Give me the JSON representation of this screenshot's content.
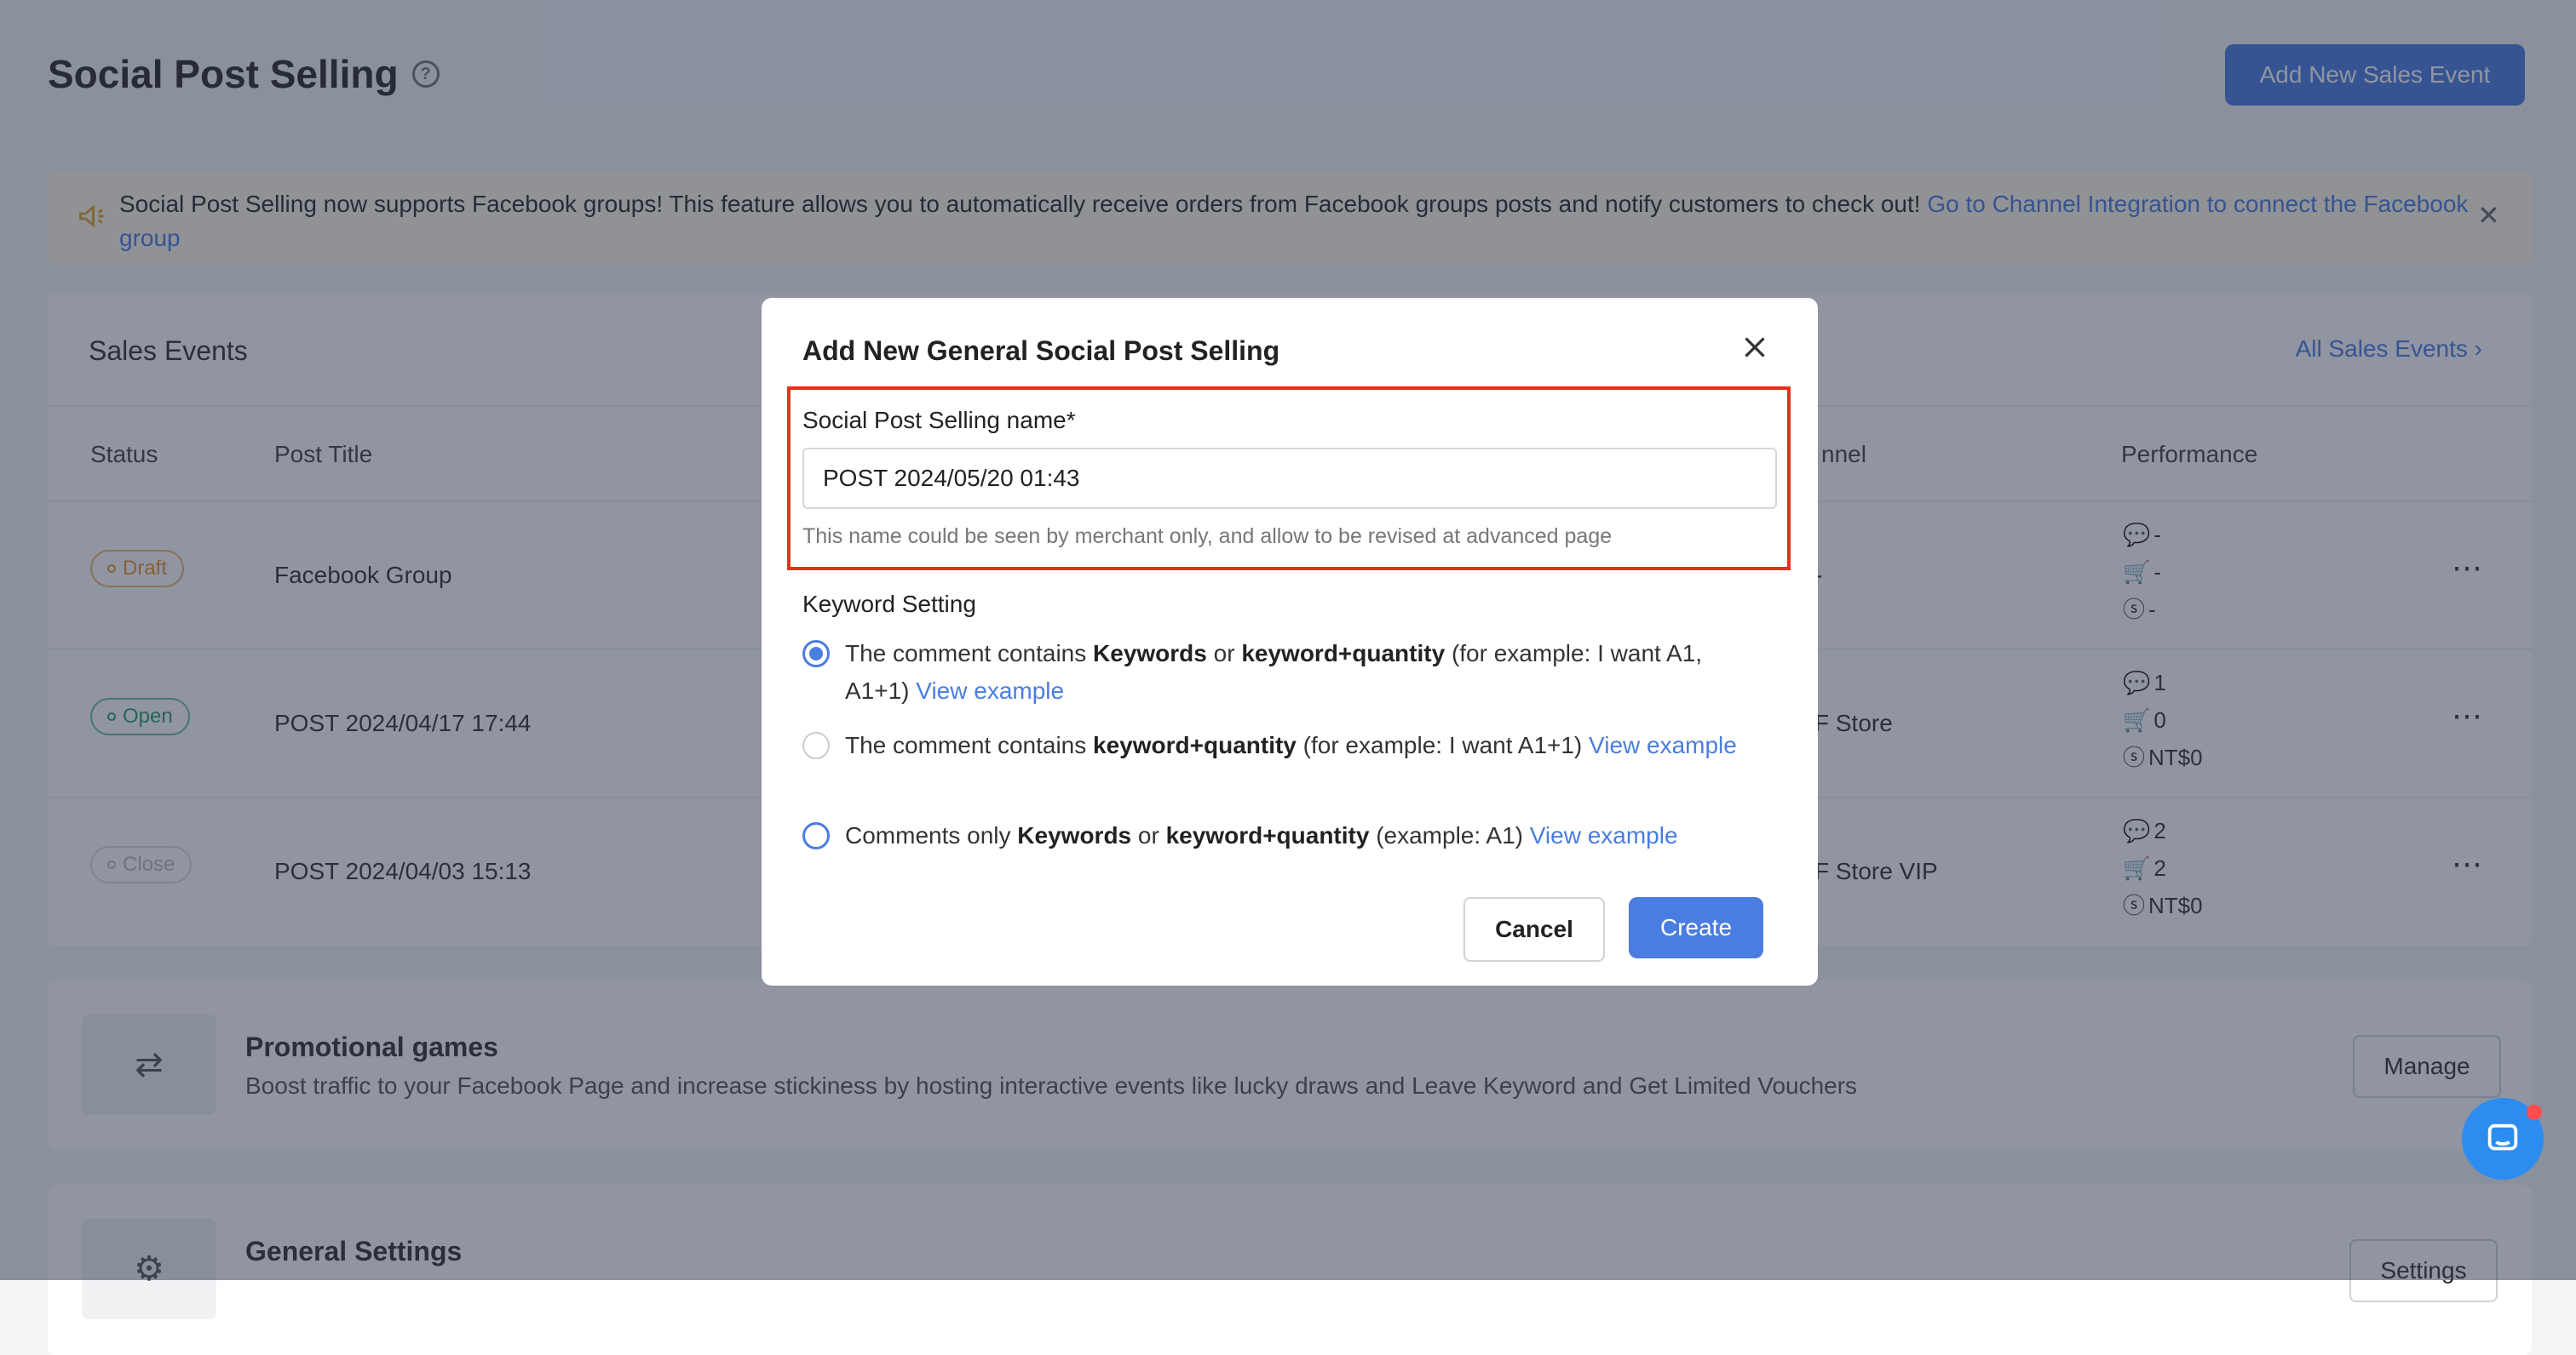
{
  "page": {
    "title": "Social Post Selling",
    "add_event_label": "Add New Sales Event"
  },
  "banner": {
    "text": "Social Post Selling now supports Facebook groups! This feature allows you to automatically receive orders from Facebook groups posts and notify customers to check out! ",
    "link": "Go to Channel Integration to connect the Facebook group"
  },
  "sales_events": {
    "title": "Sales Events",
    "all_link": "All Sales Events ›",
    "columns": [
      "Status",
      "Post Title",
      "nnel",
      "Performance"
    ],
    "rows": [
      {
        "status": "Draft",
        "title": "Facebook Group",
        "channel": "-",
        "comments": "-",
        "orders": "-",
        "revenue": "-"
      },
      {
        "status": "Open",
        "title": "POST 2024/04/17 17:44",
        "channel": "F Store",
        "comments": "1",
        "orders": "0",
        "revenue": "NT$0"
      },
      {
        "status": "Close",
        "title": "POST 2024/04/03 15:13",
        "channel": "F Store VIP",
        "comments": "2",
        "orders": "2",
        "revenue": "NT$0"
      }
    ]
  },
  "promo": {
    "title": "Promotional games",
    "subtitle": "Boost traffic to your Facebook Page and increase stickiness by hosting interactive events like lucky draws and Leave Keyword and Get Limited Vouchers",
    "button": "Manage"
  },
  "settings": {
    "title": "General Settings",
    "button": "Settings"
  },
  "modal": {
    "title": "Add New General Social Post Selling",
    "name_label": "Social Post Selling name*",
    "name_value": "POST 2024/05/20 01:43",
    "name_hint": "This name could be seen by merchant only, and allow to be revised at advanced page",
    "keyword_label": "Keyword Setting",
    "options": [
      {
        "pre": "The comment contains ",
        "b1": "Keywords",
        "mid": " or ",
        "b2": "keyword+quantity",
        "post": " (for example: I want A1, A1+1) ",
        "link": "View example"
      },
      {
        "pre": "The comment contains ",
        "b1": "",
        "mid": "",
        "b2": "keyword+quantity",
        "post": " (for example: I want A1+1) ",
        "link": "View example"
      },
      {
        "pre": "Comments only ",
        "b1": "Keywords",
        "mid": " or ",
        "b2": "keyword+quantity",
        "post": " (example: A1) ",
        "link": "View example"
      }
    ],
    "cancel_label": "Cancel",
    "create_label": "Create"
  },
  "colors": {
    "accent": "#4a7de0",
    "highlight": "#e8301c"
  }
}
